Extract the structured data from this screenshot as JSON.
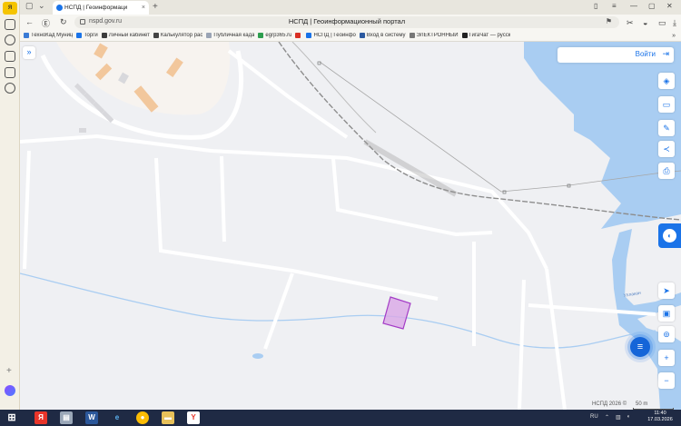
{
  "browser": {
    "tab": {
      "title": "НСПД | Геоинформаци"
    },
    "address": {
      "url": "nspd.gov.ru",
      "page_title": "НСПД | Геоинформационный портал"
    },
    "bookmarks": [
      {
        "label": "ТехноКад Муниц",
        "color": "#3a7bd5"
      },
      {
        "label": "Торги",
        "color": "#1a73e8"
      },
      {
        "label": "Личный кабинет",
        "color": "#3c3c3c"
      },
      {
        "label": "Калькулятор рас",
        "color": "#444444"
      },
      {
        "label": "Публичная када",
        "color": "#9aa4b5"
      },
      {
        "label": "egrp365.ru",
        "color": "#2e9e4f"
      },
      {
        "label": "",
        "color": "#d93025"
      },
      {
        "label": "НСПД | Геоинфо",
        "color": "#1a73e8"
      },
      {
        "label": "Вход в систему",
        "color": "#2c5aa0"
      },
      {
        "label": "ЭЛЕКТРОННЫЙ",
        "color": "#777777"
      },
      {
        "label": "ГигаЧат — русск",
        "color": "#222222"
      }
    ]
  },
  "map": {
    "login_label": "Войти",
    "river_label": "Уллакан",
    "copyright": "НСПД 2026 ©",
    "scale_label": "50 m",
    "colors": {
      "water": "#a9cdf2",
      "land": "#eff0f3",
      "parcel": "#d9a8e6",
      "parcel_stroke": "#a43cc6",
      "building": "#f2c79c",
      "accent": "#1a73e8"
    }
  },
  "taskbar": {
    "lang": "RU",
    "time": "11:40",
    "date": "17.03.2026"
  }
}
